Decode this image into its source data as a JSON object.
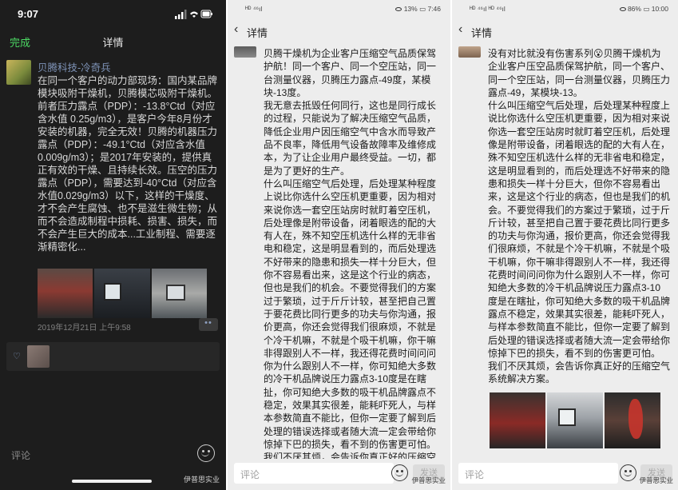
{
  "panel1": {
    "status_time": "9:07",
    "nav": {
      "done_label": "完成",
      "title": "详情"
    },
    "author": "贝腾科技-冷奇兵",
    "body": "在同一个客户的动力部现场：国内某品牌模块吸附干燥机，贝腾模芯吸附干燥机。前者压力露点（PDP）：-13.8°Ctd（对应含水值 0.25g/m3），是客户今年8月份才安装的机器，完全无效！贝腾的机器压力露点（PDP）：-49.1°Ctd（对应含水值 0.009g/m3）；是2017年安装的，提供真正有效的干燥、且持续长效。压空的压力露点（PDP），需要达到-40°Ctd（对应含水值0.029g/m3）以下，这样的干燥度、才不会产生腐蚀、也不是滋生微生物；从而不会造成制程中损耗、损害、损失，而不会产生巨大的成本...工业制程、需要逐渐精密化...",
    "date": "2019年12月21日 上午9:58",
    "more_label": "••",
    "comment_placeholder": "评论",
    "watermark": "伊普思实业"
  },
  "panel2": {
    "status_left": "ᴴᴰ ⁴⁶ıl",
    "status_right": "13% ▭ 7:46",
    "nav": {
      "back": "‹",
      "title": "详情"
    },
    "body": "贝腾干燥机为企业客户压缩空气品质保驾护航！同一个客户、同一个空压站，同一台测量仪器，贝腾压力露点-49度，某模块-13度。\n    我无意去抵毁任何同行，这也是同行成长的过程，只能说为了解决压缩空气品质，降低企业用户因压缩空气中含水而导致产品不良率，降低用气设备故障率及维修成本，为了让企业用户最终受益。一切，都是为了更好的生产。\n    什么叫压缩空气后处理，后处理某种程度上说比你选什么空压机更重要，因为相对来说你选一套空压站房时就盯着空压机，后处理像是附带设备，闭着眼选的配的大有人在，殊不知空压机选什么样的无非省电和稳定，这是明显看到的，而后处理选不好带来的隐患和损失一样十分巨大，但你不容易看出来，这是这个行业的病态，但也是我们的机会。不要觉得我们的方案过于繁琐，过于斤斤计较，甚至把自己置于要花费比同行更多的功夫与你沟通，报价更高，你还会觉得我们很麻烦，不就是个冷干机嘛，不就是个吸干机嘛，你干嘛非得跟别人不一样，我还得花费时间问问你为什么跟别人不一样，你可知绝大多数的冷干机品牌说压力露点3-10度是在瞎扯，你可知绝大多数的吸干机品牌露点不稳定，效果其实很差，能耗吓死人，与样本参数简直不能比，但你一定要了解到后处理的错误选择或者随大流一定会带给你惊掉下巴的损失，看不到的伤害更可怕。\n我们不厌其烦，会告诉你真正好的压缩空气系统解决方案。",
    "comment_placeholder": "评论",
    "send_label": "发送",
    "watermark": "伊普思实业"
  },
  "panel3": {
    "status_left": "ᴴᴰ ⁴⁶ıl ᴴᴰ ⁴⁶ıl",
    "status_right": "86% ▭ 10:00",
    "nav": {
      "back": "‹",
      "title": "详情"
    },
    "body": "没有对比就没有伤害系列😮贝腾干燥机为企业客户压空品质保驾护航，同一个客户、同一个空压站，同一台测量仪器，贝腾压力露点-49，某模块-13。\n什么叫压缩空气后处理，后处理某种程度上说比你选什么空压机更重要，因为相对来说你选一套空压站房时就盯着空压机，后处理像是附带设备，闭着眼选的配的大有人在，殊不知空压机选什么样的无非省电和稳定，这是明显看到的，而后处理选不好带来的隐患和损失一样十分巨大，但你不容易看出来，这是这个行业的病态，但也是我们的机会。不要觉得我们的方案过于繁琐，过于斤斤计较，甚至把自己置于要花费比同行更多的功夫与你沟通，报价更高，你还会觉得我们很麻烦，不就是个冷干机嘛，不就是个吸干机嘛，你干嘛非得跟别人不一样，我还得花费时间问问你为什么跟别人不一样，你可知绝大多数的冷干机品牌说压力露点3-10度是在瞎扯，你可知绝大多数的吸干机品牌露点不稳定，效果其实很差，能耗吓死人，与样本参数简直不能比，但你一定要了解到后处理的错误选择或者随大流一定会带给你惊掉下巴的损失，看不到的伤害更可怕。\n我们不厌其烦，会告诉你真正好的压缩空气系统解决方案。",
    "comment_placeholder": "评论",
    "send_label": "发送",
    "watermark": "伊普思实业"
  },
  "icons": {
    "signal": "signal-icon",
    "wifi": "wifi-icon",
    "battery": "battery-icon",
    "heart": "heart-icon",
    "emoji": "emoji-icon",
    "back": "chevron-left-icon"
  },
  "colors": {
    "done_green": "#4cd964",
    "author_blue": "#7e93b7",
    "dark_bg": "#1d1d1d",
    "light_bg": "#ededed"
  }
}
